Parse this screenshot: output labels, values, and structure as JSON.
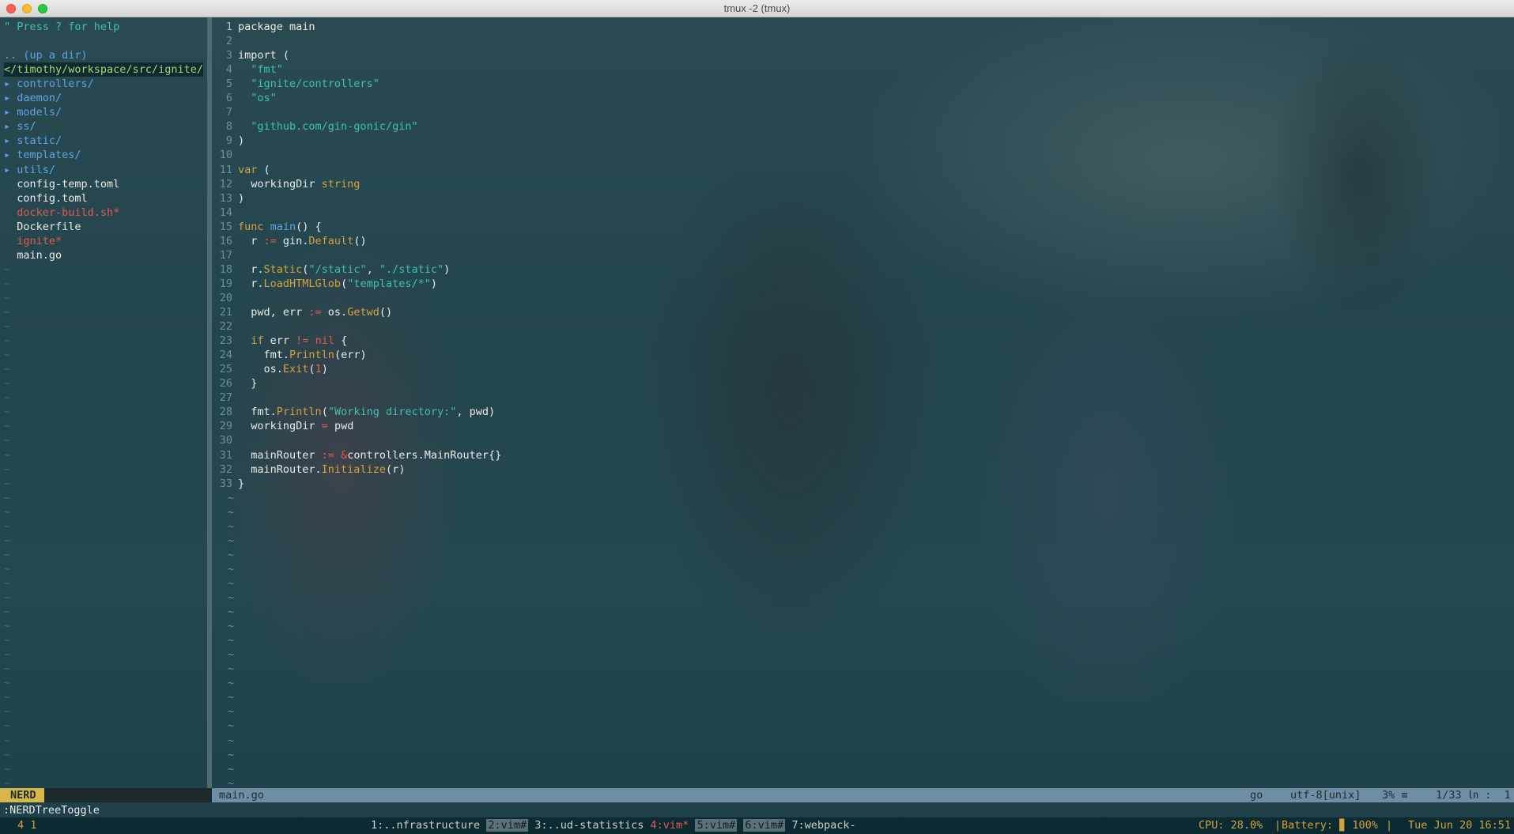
{
  "window": {
    "title": "tmux -2 (tmux)"
  },
  "nerdtree": {
    "help": "\" Press ? for help",
    "updir": ".. (up a dir)",
    "root": "</timothy/workspace/src/ignite/",
    "entries": [
      {
        "name": "controllers/",
        "kind": "dir"
      },
      {
        "name": "daemon/",
        "kind": "dir"
      },
      {
        "name": "models/",
        "kind": "dir"
      },
      {
        "name": "ss/",
        "kind": "dir"
      },
      {
        "name": "static/",
        "kind": "dir"
      },
      {
        "name": "templates/",
        "kind": "dir"
      },
      {
        "name": "utils/",
        "kind": "dir"
      },
      {
        "name": "config-temp.toml",
        "kind": "file"
      },
      {
        "name": "config.toml",
        "kind": "file"
      },
      {
        "name": "docker-build.sh*",
        "kind": "exec"
      },
      {
        "name": "Dockerfile",
        "kind": "file"
      },
      {
        "name": "ignite*",
        "kind": "exec"
      },
      {
        "name": "main.go",
        "kind": "file"
      }
    ],
    "arrow": "▸",
    "tilde": "~"
  },
  "editor": {
    "code": [
      [
        [
          "package main",
          ""
        ]
      ],
      [],
      [
        [
          "import (",
          ""
        ]
      ],
      [
        [
          "  ",
          ""
        ],
        [
          "\"fmt\"",
          "str"
        ]
      ],
      [
        [
          "  ",
          ""
        ],
        [
          "\"ignite/controllers\"",
          "str"
        ]
      ],
      [
        [
          "  ",
          ""
        ],
        [
          "\"os\"",
          "str"
        ]
      ],
      [],
      [
        [
          "  ",
          ""
        ],
        [
          "\"github.com/gin-gonic/gin\"",
          "str"
        ]
      ],
      [
        [
          ")",
          ""
        ]
      ],
      [],
      [
        [
          "var",
          "kw"
        ],
        [
          " (",
          ""
        ]
      ],
      [
        [
          "  workingDir ",
          ""
        ],
        [
          "string",
          "kw"
        ]
      ],
      [
        [
          ")",
          ""
        ]
      ],
      [],
      [
        [
          "func",
          "kw"
        ],
        [
          " ",
          ""
        ],
        [
          "main",
          "fn"
        ],
        [
          "() {",
          ""
        ]
      ],
      [
        [
          "  r ",
          ""
        ],
        [
          ":=",
          "op"
        ],
        [
          " gin.",
          ""
        ],
        [
          "Default",
          "call"
        ],
        [
          "()",
          ""
        ]
      ],
      [],
      [
        [
          "  r.",
          ""
        ],
        [
          "Static",
          "call"
        ],
        [
          "(",
          ""
        ],
        [
          "\"/static\"",
          "str"
        ],
        [
          ", ",
          ""
        ],
        [
          "\"./static\"",
          "str"
        ],
        [
          ")",
          ""
        ]
      ],
      [
        [
          "  r.",
          ""
        ],
        [
          "LoadHTMLGlob",
          "call"
        ],
        [
          "(",
          ""
        ],
        [
          "\"templates/*\"",
          "str"
        ],
        [
          ")",
          ""
        ]
      ],
      [],
      [
        [
          "  pwd, err ",
          ""
        ],
        [
          ":=",
          "op"
        ],
        [
          " os.",
          ""
        ],
        [
          "Getwd",
          "call"
        ],
        [
          "()",
          ""
        ]
      ],
      [],
      [
        [
          "  ",
          ""
        ],
        [
          "if",
          "kw"
        ],
        [
          " err ",
          ""
        ],
        [
          "!=",
          "op"
        ],
        [
          " ",
          ""
        ],
        [
          "nil",
          "nil"
        ],
        [
          " {",
          ""
        ]
      ],
      [
        [
          "    fmt.",
          ""
        ],
        [
          "Println",
          "call"
        ],
        [
          "(err)",
          ""
        ]
      ],
      [
        [
          "    os.",
          ""
        ],
        [
          "Exit",
          "call"
        ],
        [
          "(",
          ""
        ],
        [
          "1",
          "num"
        ],
        [
          ")",
          ""
        ]
      ],
      [
        [
          "  }",
          ""
        ]
      ],
      [],
      [
        [
          "  fmt.",
          ""
        ],
        [
          "Println",
          "call"
        ],
        [
          "(",
          ""
        ],
        [
          "\"Working directory:\"",
          "str"
        ],
        [
          ", pwd)",
          ""
        ]
      ],
      [
        [
          "  workingDir ",
          ""
        ],
        [
          "=",
          "op"
        ],
        [
          " pwd",
          ""
        ]
      ],
      [],
      [
        [
          "  mainRouter ",
          ""
        ],
        [
          ":=",
          "op"
        ],
        [
          " ",
          ""
        ],
        [
          "&",
          "op"
        ],
        [
          "controllers.MainRouter{}",
          ""
        ]
      ],
      [
        [
          "  mainRouter.",
          ""
        ],
        [
          "Initialize",
          "call"
        ],
        [
          "(r)",
          ""
        ]
      ],
      [
        [
          "}",
          ""
        ]
      ]
    ]
  },
  "statusline": {
    "mode": "NERD",
    "filename": "main.go",
    "filetype": "go",
    "encoding": "utf-8[unix]",
    "percent": "3% ≡",
    "position": "1/33 ㏑ :  1"
  },
  "cmdline": ":NERDTreeToggle",
  "tmux": {
    "session": "4 1",
    "windows": [
      {
        "label": "1:..nfrastructure",
        "style": "normal"
      },
      {
        "label": "2:vim#",
        "style": "highlight"
      },
      {
        "label": "3:..ud-statistics",
        "style": "normal"
      },
      {
        "label": "4:vim*",
        "style": "active"
      },
      {
        "label": "5:vim#",
        "style": "highlight"
      },
      {
        "label": "6:vim#",
        "style": "highlight"
      },
      {
        "label": "7:webpack-",
        "style": "normal"
      }
    ],
    "cpu": "CPU: 28.0%",
    "battery": "Battery: ▊ 100%",
    "datetime": "Tue Jun 20 16:51"
  }
}
